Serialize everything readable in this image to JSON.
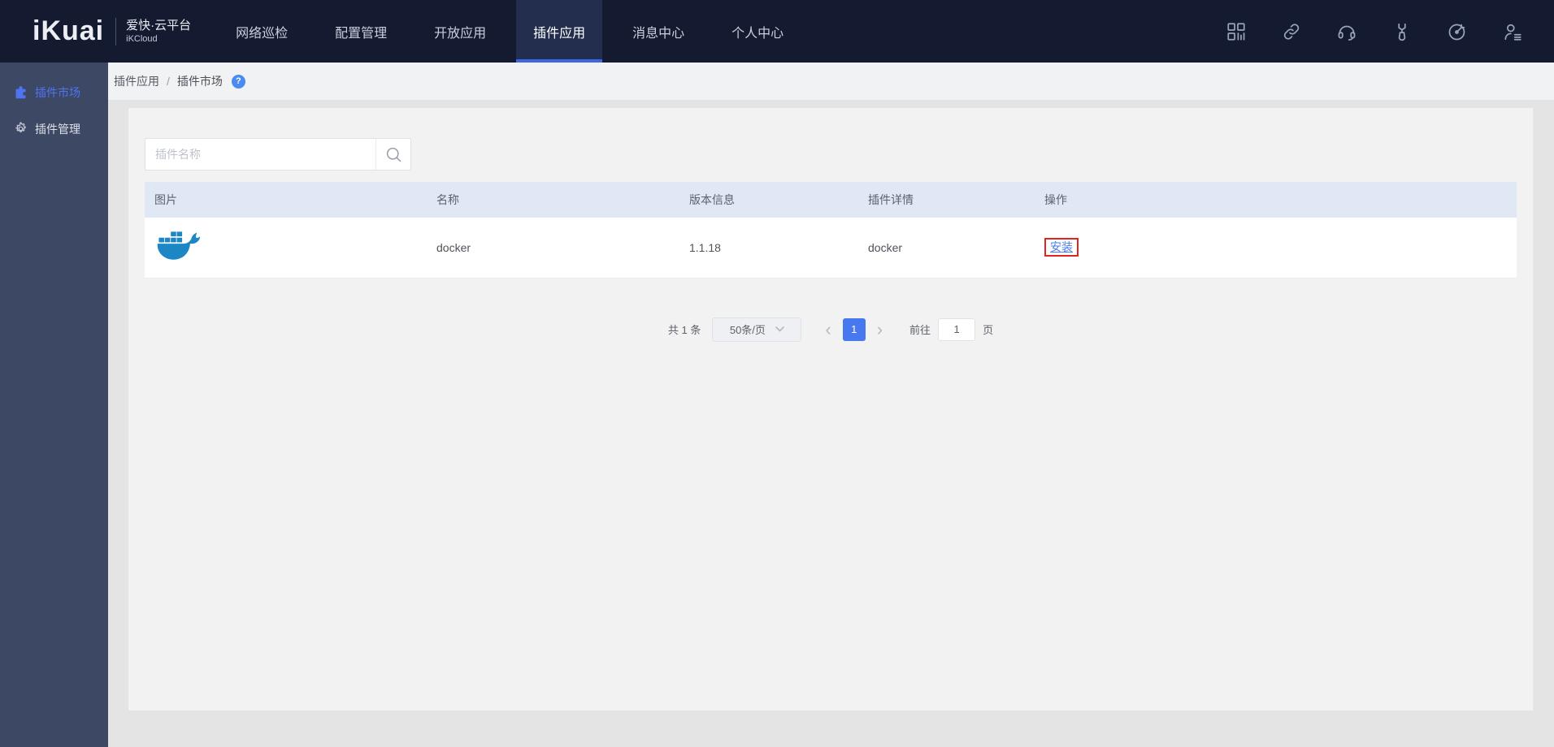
{
  "navbar": {
    "logo_text": "iKuai",
    "brand_title": "爱快·云平台",
    "brand_subtitle": "iKCloud",
    "menu": [
      {
        "label": "网络巡检",
        "active": false
      },
      {
        "label": "配置管理",
        "active": false
      },
      {
        "label": "开放应用",
        "active": false
      },
      {
        "label": "插件应用",
        "active": true
      },
      {
        "label": "消息中心",
        "active": false
      },
      {
        "label": "个人中心",
        "active": false
      }
    ],
    "action_icons": [
      "apps-grid-icon",
      "link-icon",
      "headset-icon",
      "wrench-icon",
      "target-icon",
      "user-list-icon"
    ]
  },
  "sidebar": {
    "items": [
      {
        "label": "插件市场",
        "icon": "puzzle-icon",
        "active": true
      },
      {
        "label": "插件管理",
        "icon": "gear-icon",
        "active": false
      }
    ]
  },
  "breadcrumb": {
    "parent": "插件应用",
    "separator": "/",
    "current": "插件市场",
    "help": "?"
  },
  "search": {
    "placeholder": "插件名称"
  },
  "table": {
    "headers": [
      "图片",
      "名称",
      "版本信息",
      "插件详情",
      "操作"
    ],
    "rows": [
      {
        "image": "docker-logo",
        "name": "docker",
        "version": "1.1.18",
        "detail": "docker",
        "action_label": "安装"
      }
    ]
  },
  "pagination": {
    "total_label": "共 1 条",
    "page_size_label": "50条/页",
    "prev_label": "‹",
    "next_label": "›",
    "current_page": "1",
    "goto_label": "前往",
    "goto_value": "1",
    "goto_unit": "页"
  },
  "colors": {
    "navbar_bg": "#141b30",
    "sidebar_bg": "#3d4865",
    "accent_blue": "#4878f0",
    "tab_underline_blue": "#4064e8",
    "table_header_bg": "#dfe8f4",
    "link_blue": "#4a7df0",
    "docker_blue": "#1d86c5",
    "annotation_red": "#e02420"
  }
}
